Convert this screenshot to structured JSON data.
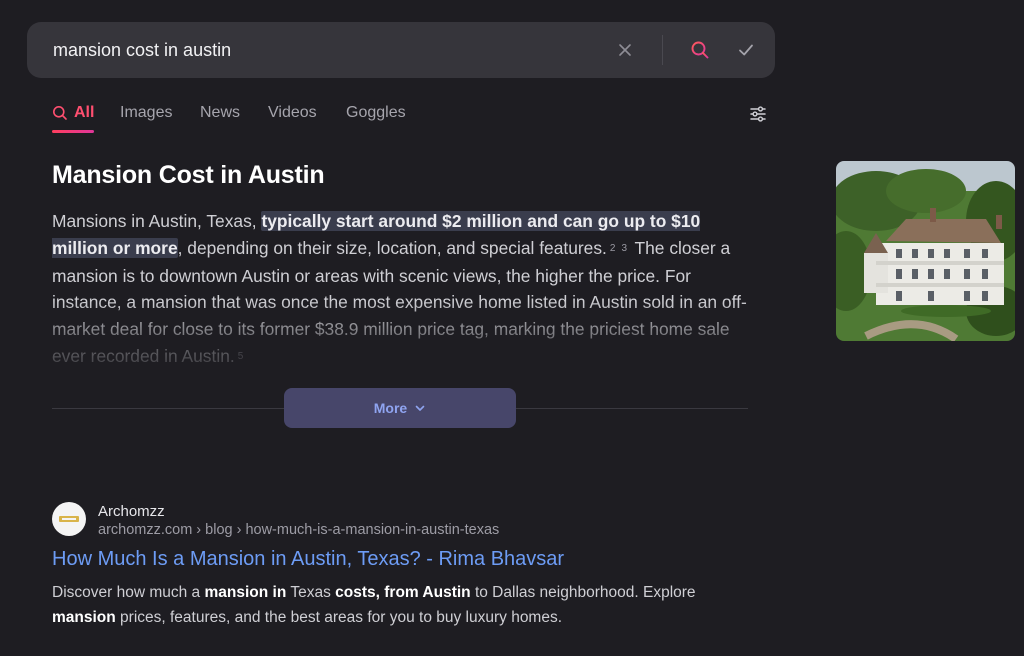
{
  "search": {
    "query": "mansion cost in austin"
  },
  "tabs": [
    {
      "label": "All",
      "active": true
    },
    {
      "label": "Images"
    },
    {
      "label": "News"
    },
    {
      "label": "Videos"
    },
    {
      "label": "Goggles"
    }
  ],
  "answer": {
    "title": "Mansion Cost in Austin",
    "p1": "Mansions in Austin, Texas, ",
    "highlight": "typically start around $2 million and can go up to $10 million or more",
    "p2": ", depending on their size, location, and special features.",
    "cite_a": "2",
    "cite_b": "3",
    "p3": " The closer a mansion is to downtown Austin or areas with scenic views, the higher the price. For instance, a mansion that was once the most expensive home listed in Austin sold in an off-market deal for close to its former $38.9 million price tag, marking the priciest home sale ever recorded in Austin.",
    "cite_c": "5",
    "more_label": "More"
  },
  "result": {
    "site_name": "Archomzz",
    "url": "archomzz.com › blog › how-much-is-a-mansion-in-austin-texas",
    "title": "How Much Is a Mansion in Austin, Texas? - Rima Bhavsar",
    "snippet_parts": [
      "Discover how much a ",
      "mansion in",
      " Texas ",
      "costs, from Austin",
      " to Dallas neighborhood. Explore ",
      "mansion",
      " prices, features, and the best areas for you to buy luxury homes."
    ]
  },
  "colors": {
    "background": "#1e1d22",
    "accent": "#ff4f70",
    "link": "#6d9cf5",
    "more_button": "#47466a"
  }
}
